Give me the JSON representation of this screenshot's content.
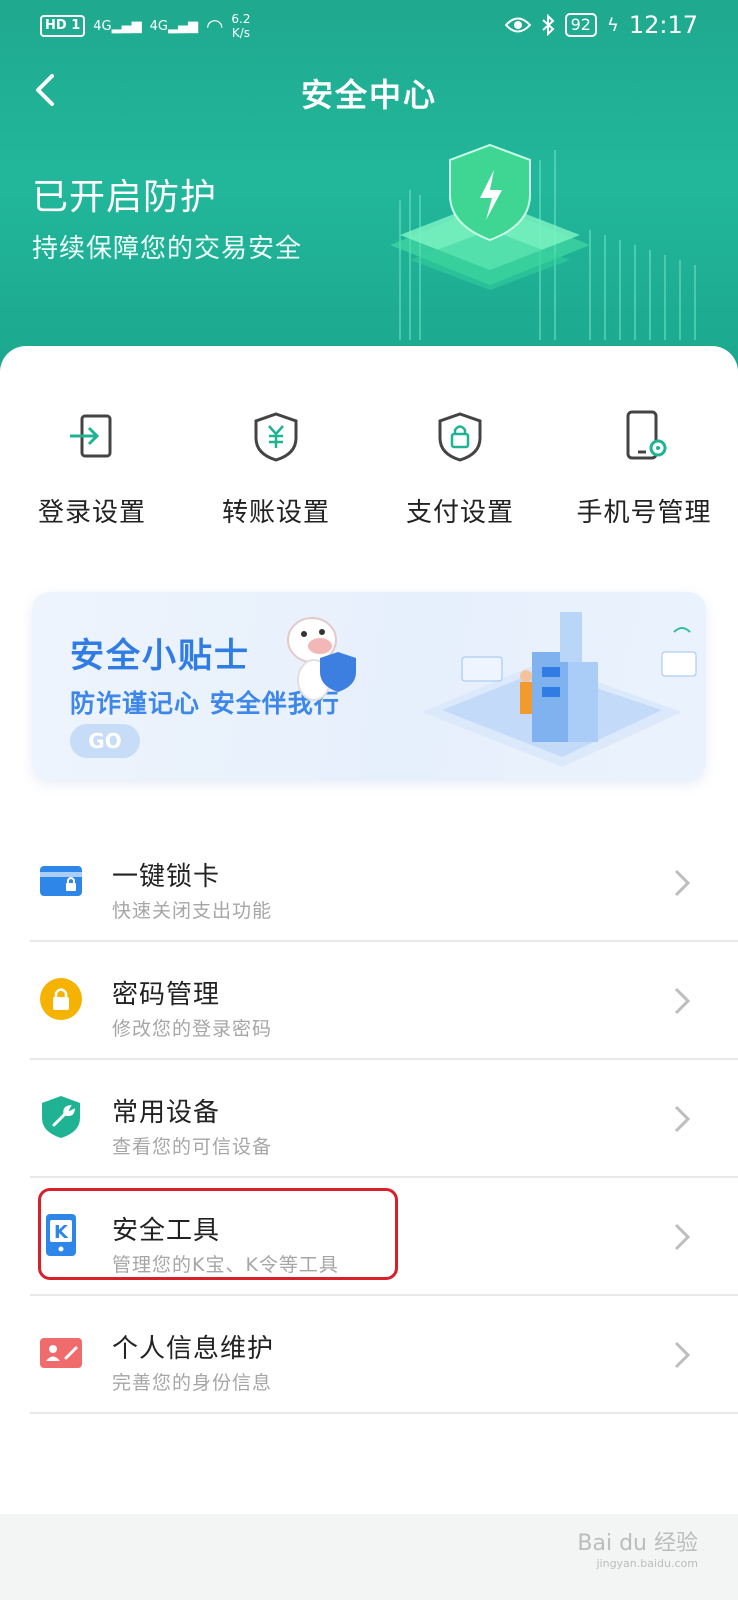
{
  "status_bar": {
    "left_badge": "HD 1",
    "network_1": "4G",
    "network_2": "4G",
    "speed_value": "6.2",
    "speed_unit": "K/s",
    "battery": "92",
    "time": "12:17"
  },
  "nav": {
    "title": "安全中心"
  },
  "banner": {
    "title": "已开启防护",
    "subtitle": "持续保障您的交易安全"
  },
  "quick_actions": [
    {
      "label": "登录设置",
      "icon": "login-icon"
    },
    {
      "label": "转账设置",
      "icon": "yuan-shield-icon"
    },
    {
      "label": "支付设置",
      "icon": "lock-shield-icon"
    },
    {
      "label": "手机号管理",
      "icon": "phone-gear-icon"
    }
  ],
  "tips": {
    "title": "安全小贴士",
    "subtitle": "防诈谨记心 安全伴我行",
    "go": "GO"
  },
  "list": [
    {
      "title": "一键锁卡",
      "subtitle": "快速关闭支出功能",
      "icon": "card-lock-icon",
      "color": "#2e86e8"
    },
    {
      "title": "密码管理",
      "subtitle": "修改您的登录密码",
      "icon": "password-lock-icon",
      "color": "#f5b300"
    },
    {
      "title": "常用设备",
      "subtitle": "查看您的可信设备",
      "icon": "wrench-shield-icon",
      "color": "#1fb394"
    },
    {
      "title": "安全工具",
      "subtitle": "管理您的K宝、K令等工具",
      "icon": "k-token-icon",
      "color": "#2e86e8"
    },
    {
      "title": "个人信息维护",
      "subtitle": "完善您的身份信息",
      "icon": "id-card-icon",
      "color": "#f06b6b"
    }
  ],
  "watermark": {
    "brand": "Bai du 经验",
    "url": "jingyan.baidu.com"
  },
  "colors": {
    "header": "#22b79b",
    "accent_blue": "#2f7de4",
    "highlight": "#d9202a"
  }
}
